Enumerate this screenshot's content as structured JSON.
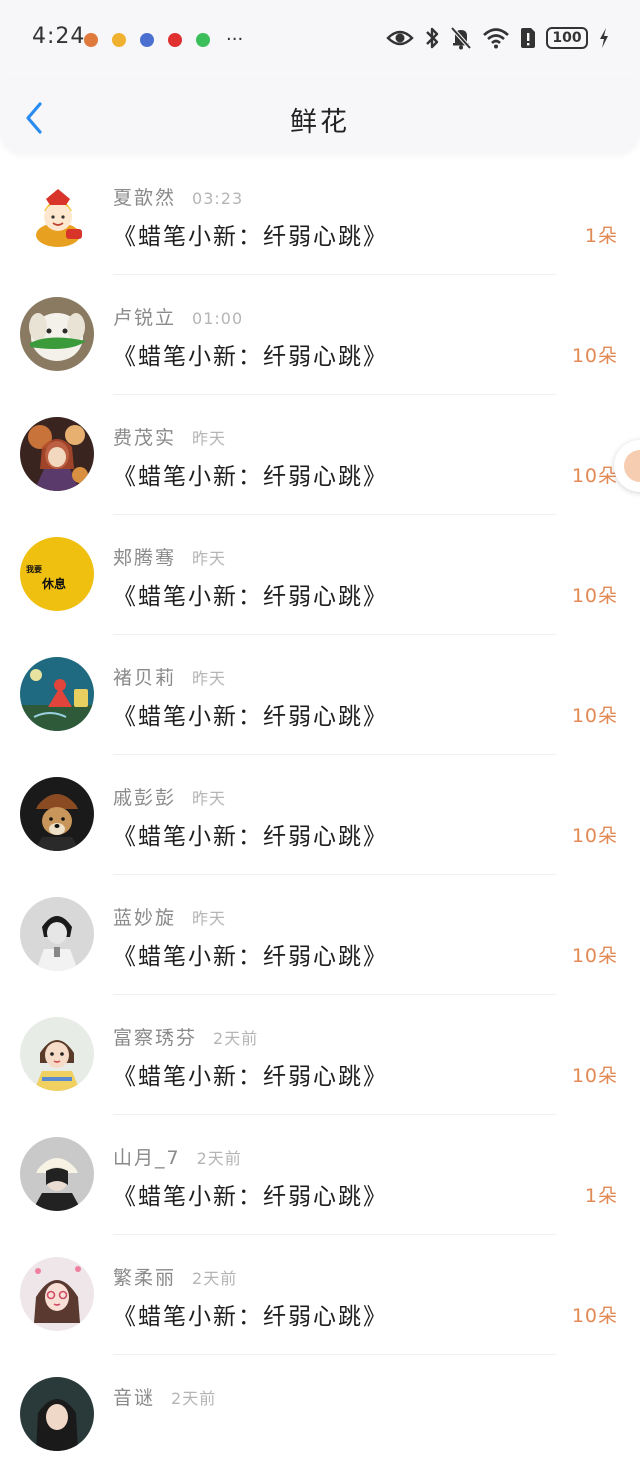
{
  "status_bar": {
    "time": "4:24",
    "battery": "100",
    "notification_icons": [
      "#e07a3c",
      "#f0b030",
      "#4a6fd0",
      "#e0302f",
      "#3cbf5a"
    ],
    "overflow": "···"
  },
  "nav": {
    "title": "鲜花",
    "accent": "#2a8cf0"
  },
  "list": [
    {
      "name": "夏歆然",
      "time": "03:23",
      "message": "《蜡笔小新：纤弱心跳》",
      "count": "1朵"
    },
    {
      "name": "卢锐立",
      "time": "01:00",
      "message": "《蜡笔小新：纤弱心跳》",
      "count": "10朵"
    },
    {
      "name": "费茂实",
      "time": "昨天",
      "message": "《蜡笔小新：纤弱心跳》",
      "count": "10朵"
    },
    {
      "name": "郏腾骞",
      "time": "昨天",
      "message": "《蜡笔小新：纤弱心跳》",
      "count": "10朵",
      "avatar_text_top": "我要",
      "avatar_text_bottom": "休息"
    },
    {
      "name": "褚贝莉",
      "time": "昨天",
      "message": "《蜡笔小新：纤弱心跳》",
      "count": "10朵"
    },
    {
      "name": "戚彭彭",
      "time": "昨天",
      "message": "《蜡笔小新：纤弱心跳》",
      "count": "10朵"
    },
    {
      "name": "蓝妙旋",
      "time": "昨天",
      "message": "《蜡笔小新：纤弱心跳》",
      "count": "10朵"
    },
    {
      "name": "富察琇芬",
      "time": "2天前",
      "message": "《蜡笔小新：纤弱心跳》",
      "count": "10朵"
    },
    {
      "name": "山月_7",
      "time": "2天前",
      "message": "《蜡笔小新：纤弱心跳》",
      "count": "1朵"
    },
    {
      "name": "繁柔丽",
      "time": "2天前",
      "message": "《蜡笔小新：纤弱心跳》",
      "count": "10朵"
    },
    {
      "name": "音谜",
      "time": "2天前",
      "message": "",
      "count": ""
    }
  ],
  "colors": {
    "count_text": "#e28a55",
    "name_text": "#8a8a8a",
    "time_text": "#b5b5b5"
  }
}
